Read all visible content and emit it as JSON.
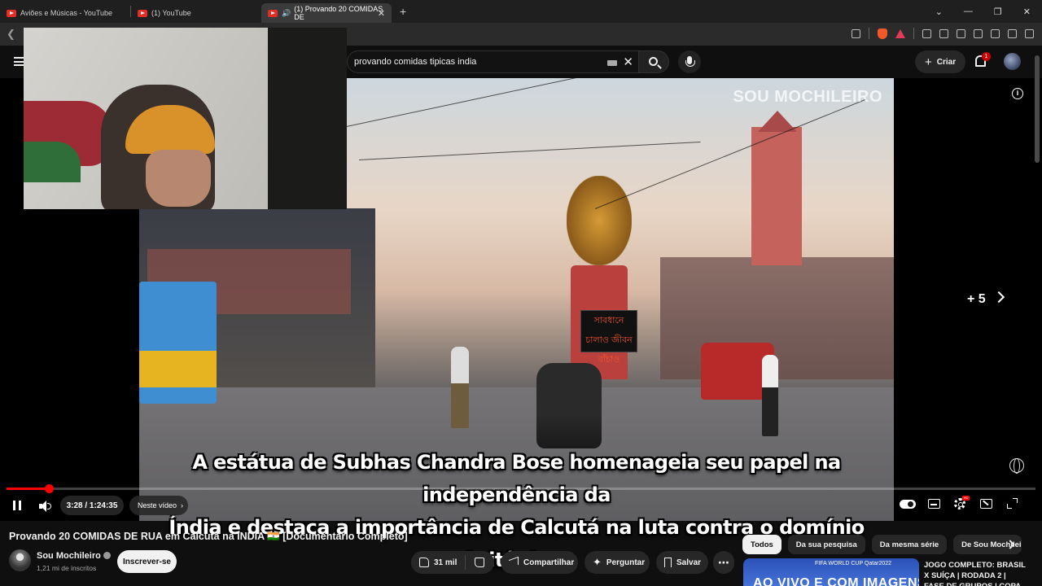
{
  "browser": {
    "tabs": [
      {
        "title": "Aviões e Músicas - YouTube",
        "active": false
      },
      {
        "title": "(1) YouTube",
        "active": false
      },
      {
        "title": "(1) Provando 20 COMIDAS DE",
        "active": true
      }
    ],
    "new_tab": "+",
    "window_controls": [
      "⌄",
      "—",
      "❐",
      "✕"
    ]
  },
  "youtube_header": {
    "search_query": "provando comidas tipicas india",
    "create_label": "Criar",
    "notification_count": "1"
  },
  "video": {
    "watermark": "SOU MOCHILEIRO",
    "sign_text": "সাবধানে চালাও জীবন বাঁচাও",
    "subtitle_line1": "A estátua de Subhas Chandra Bose homenageia seu papel na independência da",
    "subtitle_line2": "Índia e destaca a importância de Calcutá na luta contra o domínio britânico.",
    "end_card_more": "+ 5",
    "current_time": "3:28",
    "duration": "1:24:35",
    "time_display": "3:28 / 1:24:35",
    "progress_fraction": 0.041,
    "buffered_fraction": 0.045,
    "chapter_label": "Neste vídeo",
    "hd_badge": "HD"
  },
  "watch": {
    "title": "Provando 20 COMIDAS DE RUA em Calcutá na INDIA 🇮🇳 [Documentário Completo]",
    "channel_name": "Sou Mochileiro",
    "subscribers": "1,21 mi de inscritos",
    "subscribe_label": "Inscrever-se",
    "likes": "31 mil",
    "share_label": "Compartilhar",
    "ask_label": "Perguntar",
    "save_label": "Salvar",
    "more_label": "⋯"
  },
  "sidebar": {
    "chips": [
      "Todos",
      "Da sua pesquisa",
      "Da mesma série",
      "De Sou Mochileiro"
    ],
    "selected_chip": "Todos",
    "recommended": {
      "thumb_text": "AO VIVO E COM IMAGENS",
      "thumb_logo": "FIFA WORLD CUP Qatar2022",
      "title": "JOGO COMPLETO: BRASIL X SUÍÇA | RODADA 2 | FASE DE GRUPOS | COPA DO MUNDO"
    }
  },
  "colors": {
    "background": "#0f0f0f",
    "progress": "#ff0000",
    "chip_selected": "#f1f1f1"
  }
}
